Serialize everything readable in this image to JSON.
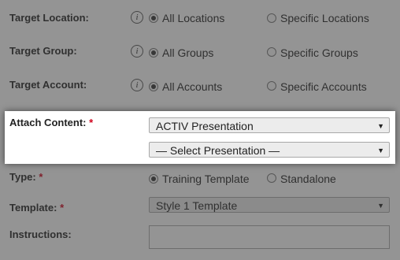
{
  "form": {
    "target_location": {
      "label": "Target Location:",
      "options": [
        "All Locations",
        "Specific Locations"
      ],
      "selected": "All Locations"
    },
    "target_group": {
      "label": "Target Group:",
      "options": [
        "All Groups",
        "Specific Groups"
      ],
      "selected": "All Groups"
    },
    "target_account": {
      "label": "Target Account:",
      "options": [
        "All Accounts",
        "Specific Accounts"
      ],
      "selected": "All Accounts"
    },
    "attach_content": {
      "label": "Attach Content:",
      "required_mark": "*",
      "content_type_value": "ACTIV Presentation",
      "presentation_value": "— Select Presentation —"
    },
    "type": {
      "label": "Type:",
      "required_mark": "*",
      "options": [
        "Training Template",
        "Standalone"
      ],
      "selected": "Training Template"
    },
    "template": {
      "label": "Template:",
      "required_mark": "*",
      "value": "Style 1 Template"
    },
    "instructions": {
      "label": "Instructions:",
      "value": ""
    }
  },
  "icons": {
    "info": "info-icon",
    "info_glyph": "i",
    "dropdown": "chevron-down-icon",
    "dropdown_glyph": "▼"
  },
  "colors": {
    "required": "#d0021b",
    "overlay": "rgba(60,60,60,0.55)",
    "select_bg": "#ececec"
  }
}
